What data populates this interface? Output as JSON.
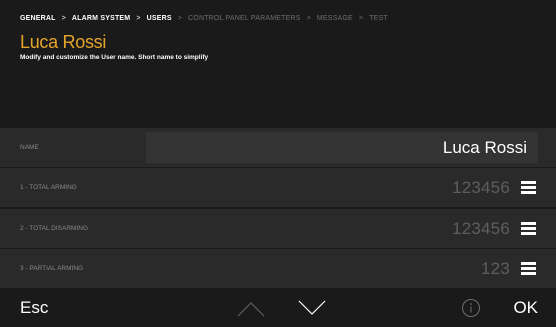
{
  "breadcrumb": {
    "items": [
      {
        "label": "GENERAL"
      },
      {
        "label": "ALARM SYSTEM"
      },
      {
        "label": "USERS"
      },
      {
        "label": "CONTROL PANEL PARAMETERS"
      },
      {
        "label": "MESSAGE"
      },
      {
        "label": "TEST"
      }
    ],
    "separator": ">"
  },
  "header": {
    "title": "Luca Rossi",
    "subtitle": "Modify and customize the User name. Short name to simplify"
  },
  "rows": [
    {
      "label": "NAME",
      "value": "Luca Rossi"
    },
    {
      "label": "1 - TOTAL ARMING",
      "value": "123456"
    },
    {
      "label": "2 - TOTAL DISARMING",
      "value": "123456"
    },
    {
      "label": "3 - PARTIAL ARMING",
      "value": "123"
    }
  ],
  "footer": {
    "esc_label": "Esc",
    "ok_label": "OK"
  },
  "icons": {
    "menu": "hamburger-menu-icon",
    "up": "chevron-up-icon",
    "down": "chevron-down-icon",
    "info": "info-icon"
  },
  "colors": {
    "accent": "#e6a529",
    "background": "#1a1a1a",
    "row": "#2a2a2a",
    "input": "#333333",
    "muted_text": "#5e5e5e"
  }
}
